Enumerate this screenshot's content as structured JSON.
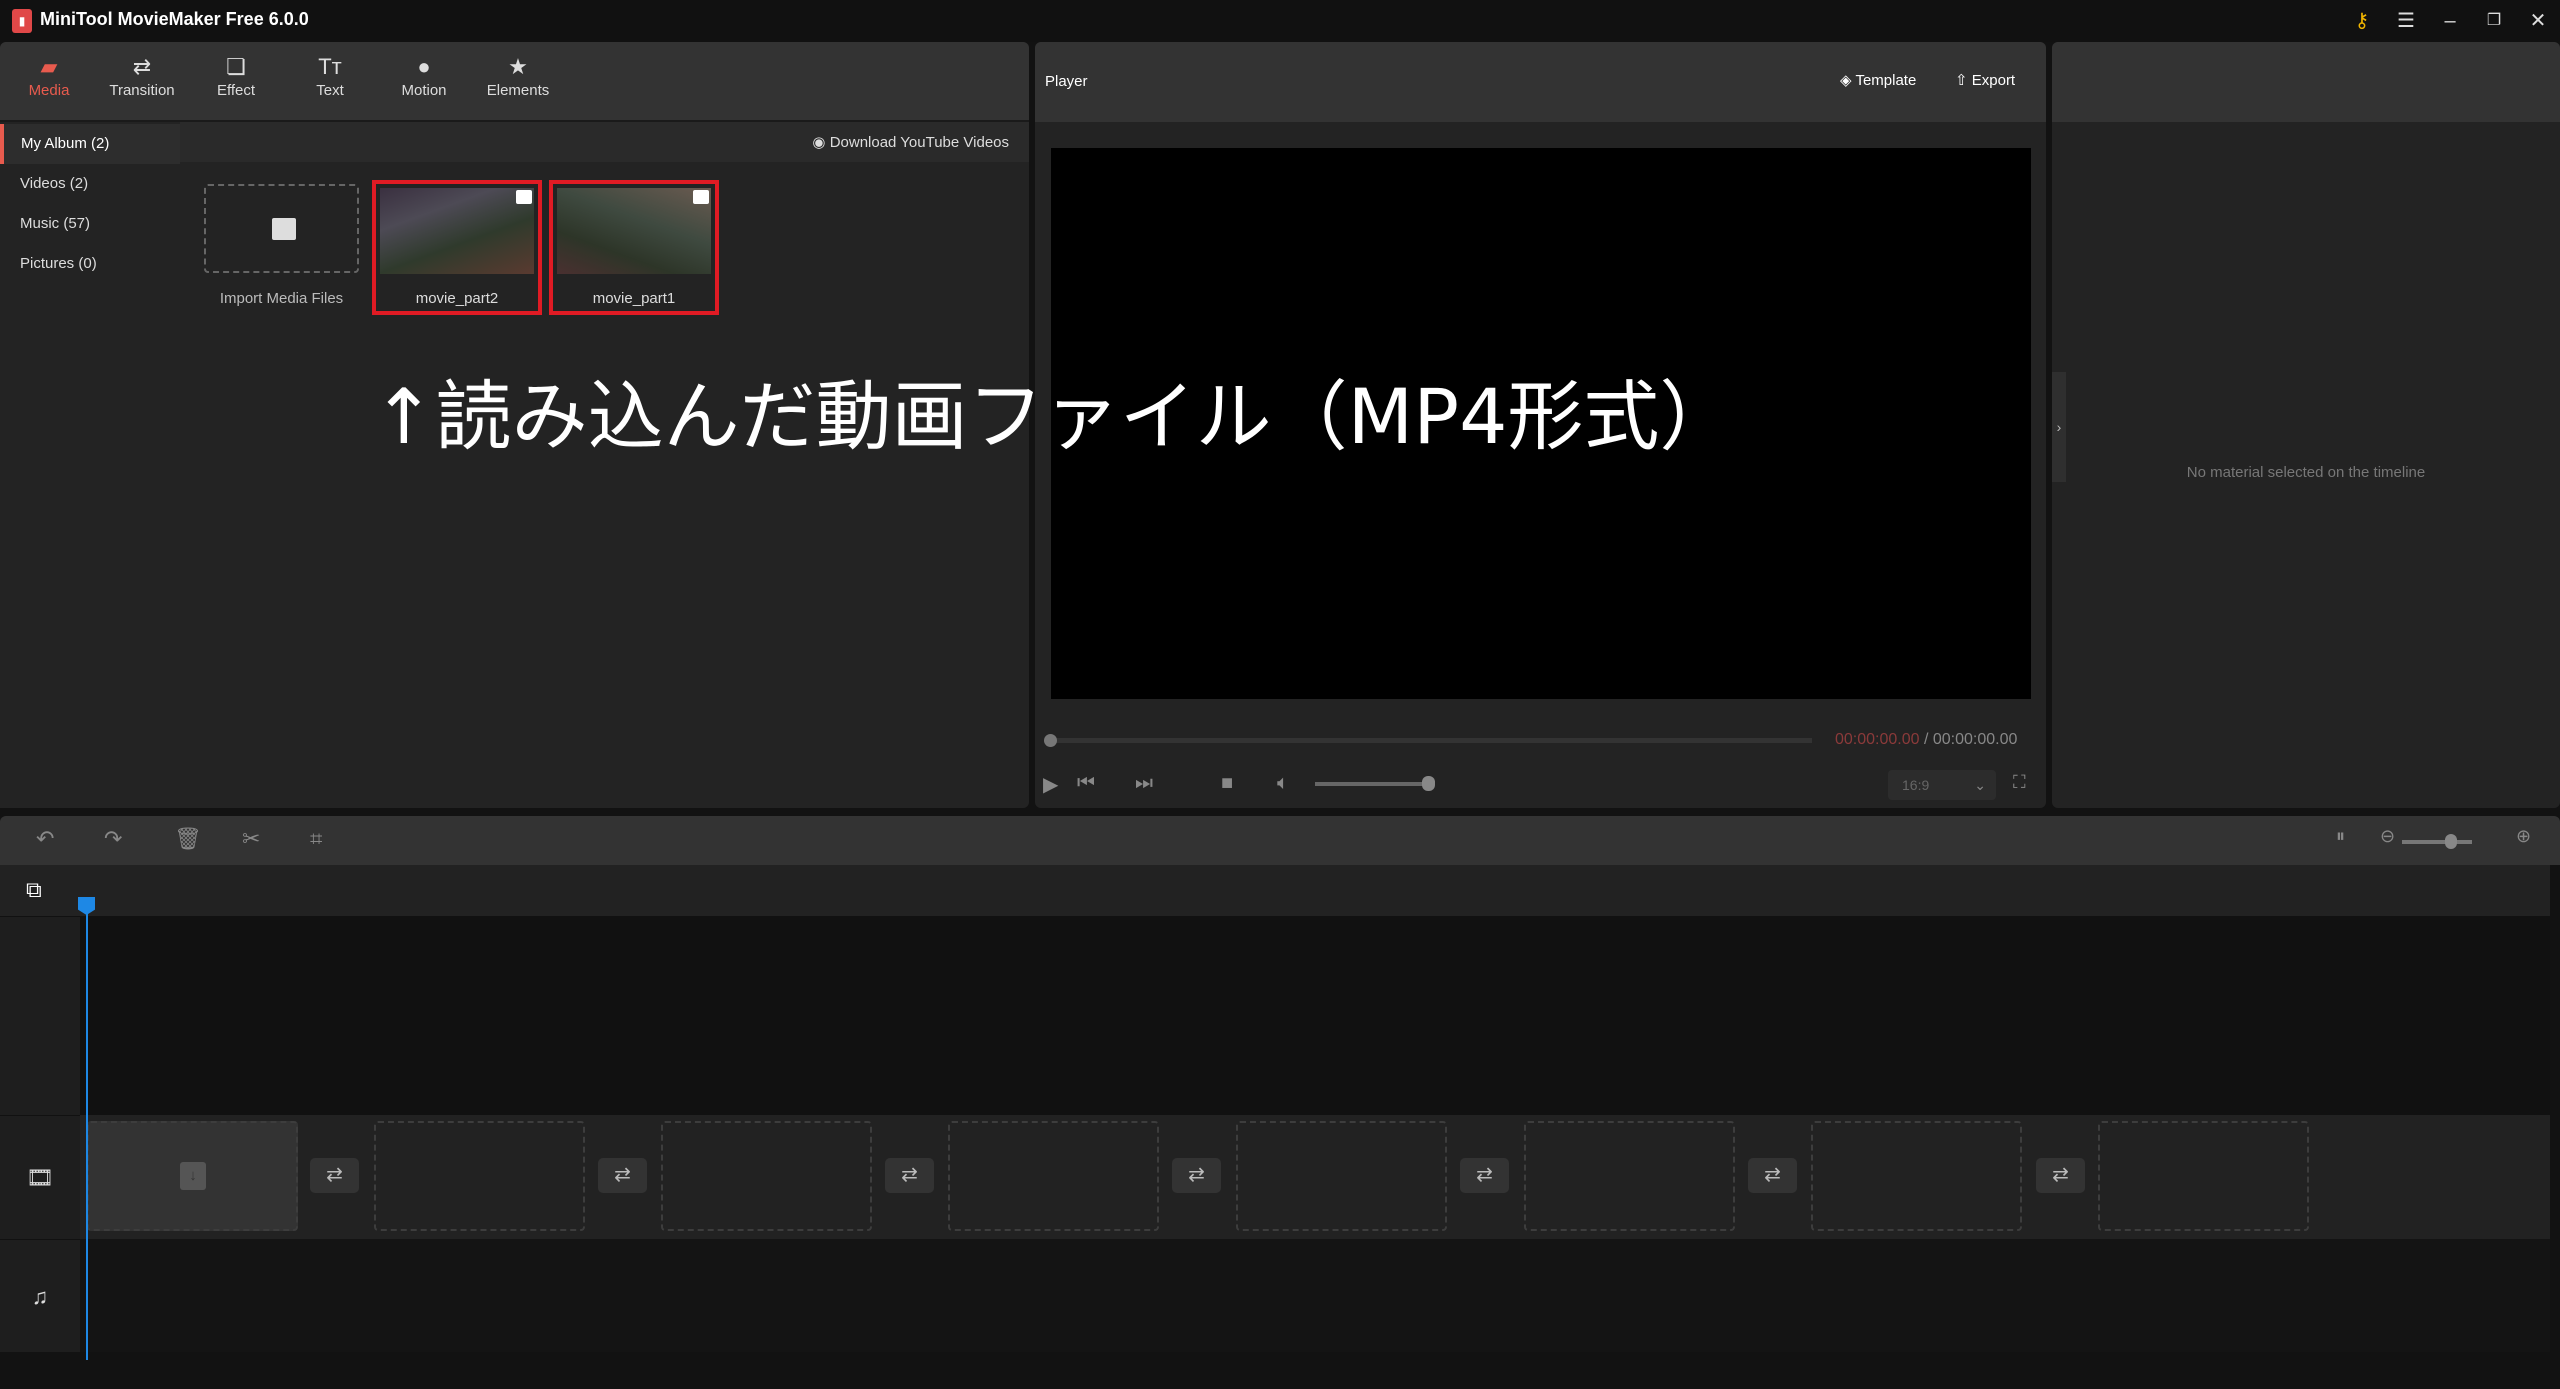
{
  "app": {
    "title": "MiniTool MovieMaker Free 6.0.0"
  },
  "toolbar": {
    "tabs": [
      {
        "label": "Media",
        "icon": "folder-icon"
      },
      {
        "label": "Transition",
        "icon": "swap-icon"
      },
      {
        "label": "Effect",
        "icon": "layers-icon"
      },
      {
        "label": "Text",
        "icon": "text-icon"
      },
      {
        "label": "Motion",
        "icon": "motion-icon"
      },
      {
        "label": "Elements",
        "icon": "star-icon"
      }
    ],
    "active": "Media"
  },
  "sidebar": {
    "items": [
      {
        "label": "My Album (2)"
      },
      {
        "label": "Videos (2)"
      },
      {
        "label": "Music (57)"
      },
      {
        "label": "Pictures (0)"
      }
    ]
  },
  "media": {
    "download_label": "Download YouTube Videos",
    "import_label": "Import Media Files",
    "items": [
      {
        "name": "movie_part2"
      },
      {
        "name": "movie_part1"
      }
    ]
  },
  "annotation": "↑読み込んだ動画ファイル（MP4形式）",
  "player": {
    "title": "Player",
    "template_label": "Template",
    "export_label": "Export",
    "time_current": "00:00:00.00",
    "time_separator": " / ",
    "time_total": "00:00:00.00",
    "aspect_ratio": "16:9",
    "volume": 1.0,
    "progress": 0
  },
  "properties": {
    "empty_message": "No material selected on the timeline"
  },
  "colors": {
    "accent": "#e85b4e",
    "highlight_border": "#e01b24",
    "playhead": "#1e88e5"
  }
}
